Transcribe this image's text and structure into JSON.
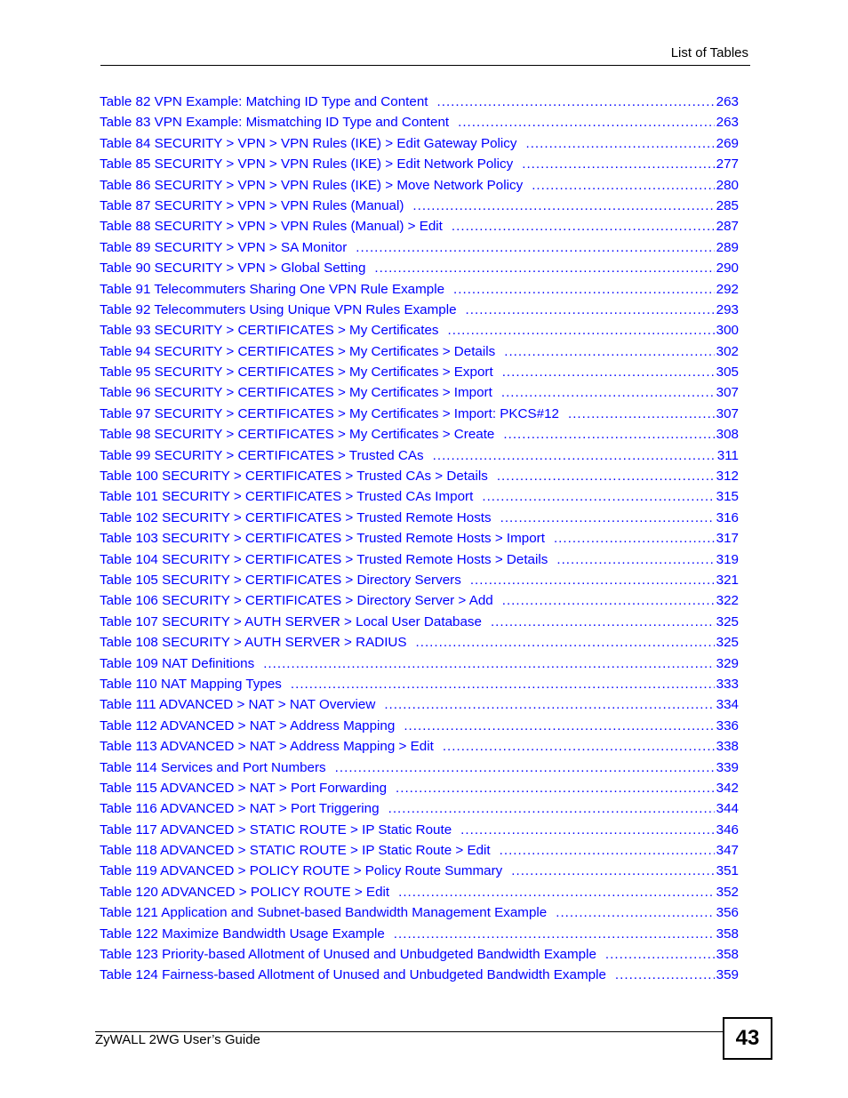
{
  "header": {
    "title": "List of Tables"
  },
  "colors": {
    "link": "#0000FF",
    "text": "#000000"
  },
  "entries": [
    {
      "label": "Table 82 VPN Example: Matching ID Type and Content",
      "page": "263"
    },
    {
      "label": "Table 83 VPN Example: Mismatching ID Type and Content",
      "page": "263"
    },
    {
      "label": "Table 84 SECURITY > VPN > VPN Rules (IKE) > Edit Gateway Policy",
      "page": "269"
    },
    {
      "label": "Table 85 SECURITY > VPN > VPN Rules (IKE) > Edit Network Policy",
      "page": "277"
    },
    {
      "label": "Table 86 SECURITY > VPN > VPN Rules (IKE) > Move Network Policy",
      "page": "280"
    },
    {
      "label": "Table 87 SECURITY > VPN > VPN Rules (Manual)",
      "page": "285"
    },
    {
      "label": "Table 88 SECURITY > VPN > VPN Rules (Manual) > Edit",
      "page": "287"
    },
    {
      "label": "Table 89 SECURITY > VPN > SA Monitor",
      "page": "289"
    },
    {
      "label": "Table 90 SECURITY > VPN > Global Setting",
      "page": "290"
    },
    {
      "label": "Table 91 Telecommuters Sharing One VPN Rule Example",
      "page": "292"
    },
    {
      "label": "Table 92 Telecommuters Using Unique VPN Rules Example",
      "page": "293"
    },
    {
      "label": "Table 93 SECURITY > CERTIFICATES > My Certificates",
      "page": "300"
    },
    {
      "label": "Table 94 SECURITY > CERTIFICATES > My Certificates > Details",
      "page": "302"
    },
    {
      "label": "Table 95 SECURITY > CERTIFICATES > My Certificates > Export",
      "page": "305"
    },
    {
      "label": "Table 96 SECURITY > CERTIFICATES > My Certificates > Import",
      "page": "307"
    },
    {
      "label": "Table 97 SECURITY > CERTIFICATES > My Certificates > Import: PKCS#12",
      "page": "307"
    },
    {
      "label": "Table 98 SECURITY > CERTIFICATES > My Certificates > Create",
      "page": "308"
    },
    {
      "label": "Table 99 SECURITY > CERTIFICATES > Trusted CAs",
      "page": "311"
    },
    {
      "label": "Table 100 SECURITY > CERTIFICATES > Trusted CAs > Details",
      "page": "312"
    },
    {
      "label": "Table 101 SECURITY > CERTIFICATES > Trusted CAs Import",
      "page": "315"
    },
    {
      "label": "Table 102 SECURITY > CERTIFICATES > Trusted Remote Hosts",
      "page": "316"
    },
    {
      "label": "Table 103 SECURITY > CERTIFICATES > Trusted Remote Hosts > Import",
      "page": "317"
    },
    {
      "label": "Table 104 SECURITY > CERTIFICATES > Trusted Remote Hosts > Details",
      "page": "319"
    },
    {
      "label": "Table 105 SECURITY > CERTIFICATES > Directory Servers",
      "page": "321"
    },
    {
      "label": "Table 106 SECURITY > CERTIFICATES > Directory Server > Add",
      "page": "322"
    },
    {
      "label": "Table 107 SECURITY > AUTH SERVER > Local User Database",
      "page": "325"
    },
    {
      "label": "Table 108 SECURITY > AUTH SERVER > RADIUS",
      "page": "325"
    },
    {
      "label": "Table 109 NAT Definitions",
      "page": "329"
    },
    {
      "label": "Table 110 NAT Mapping Types",
      "page": "333"
    },
    {
      "label": "Table 111 ADVANCED > NAT > NAT Overview",
      "page": "334"
    },
    {
      "label": "Table 112 ADVANCED > NAT > Address Mapping",
      "page": "336"
    },
    {
      "label": "Table 113 ADVANCED > NAT > Address Mapping > Edit",
      "page": "338"
    },
    {
      "label": "Table 114 Services and Port Numbers",
      "page": "339"
    },
    {
      "label": "Table 115 ADVANCED > NAT > Port Forwarding",
      "page": "342"
    },
    {
      "label": "Table 116 ADVANCED > NAT > Port Triggering",
      "page": "344"
    },
    {
      "label": "Table 117 ADVANCED > STATIC ROUTE > IP Static Route",
      "page": "346"
    },
    {
      "label": "Table 118 ADVANCED > STATIC ROUTE > IP Static Route > Edit",
      "page": "347"
    },
    {
      "label": "Table 119 ADVANCED > POLICY ROUTE > Policy Route Summary",
      "page": "351"
    },
    {
      "label": "Table 120 ADVANCED > POLICY ROUTE > Edit",
      "page": "352"
    },
    {
      "label": "Table 121 Application and Subnet-based Bandwidth Management Example",
      "page": "356"
    },
    {
      "label": "Table 122 Maximize Bandwidth Usage Example",
      "page": "358"
    },
    {
      "label": "Table 123 Priority-based Allotment of Unused and Unbudgeted Bandwidth Example",
      "page": "358"
    },
    {
      "label": "Table 124 Fairness-based Allotment of Unused and Unbudgeted Bandwidth Example",
      "page": "359"
    }
  ],
  "footer": {
    "title": "ZyWALL 2WG User’s Guide",
    "page_number": "43"
  }
}
